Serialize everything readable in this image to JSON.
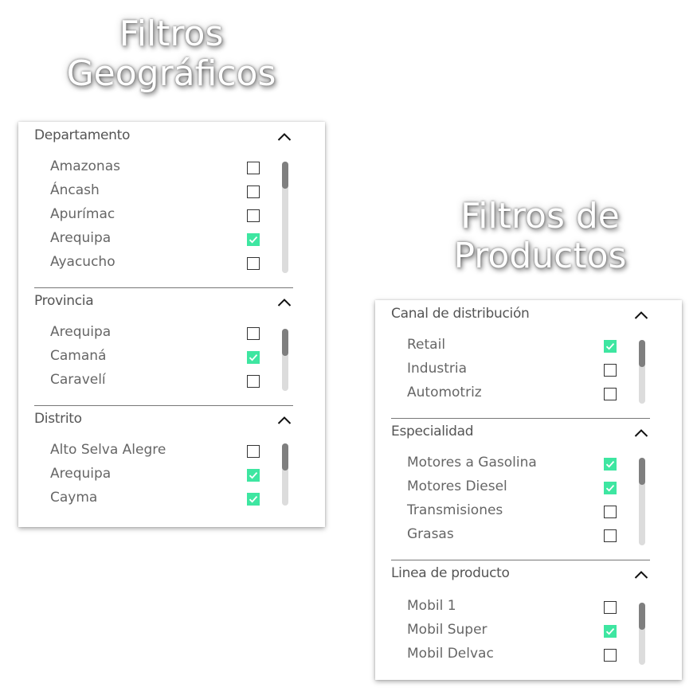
{
  "geo": {
    "title_line1": "Filtros",
    "title_line2": "Geográficos",
    "sections": [
      {
        "header": "Departamento",
        "items": [
          {
            "label": "Amazonas",
            "checked": false
          },
          {
            "label": "Áncash",
            "checked": false
          },
          {
            "label": "Apurímac",
            "checked": false
          },
          {
            "label": "Arequipa",
            "checked": true
          },
          {
            "label": "Ayacucho",
            "checked": false
          }
        ]
      },
      {
        "header": "Provincia",
        "items": [
          {
            "label": "Arequipa",
            "checked": false
          },
          {
            "label": "Camaná",
            "checked": true
          },
          {
            "label": "Caravelí",
            "checked": false
          }
        ]
      },
      {
        "header": "Distrito",
        "items": [
          {
            "label": "Alto Selva Alegre",
            "checked": false
          },
          {
            "label": "Arequipa",
            "checked": true
          },
          {
            "label": "Cayma",
            "checked": true
          }
        ]
      }
    ]
  },
  "prod": {
    "title_line1": "Filtros de",
    "title_line2": "Productos",
    "sections": [
      {
        "header": "Canal de distribución",
        "items": [
          {
            "label": "Retail",
            "checked": true
          },
          {
            "label": "Industria",
            "checked": false
          },
          {
            "label": "Automotriz",
            "checked": false
          }
        ]
      },
      {
        "header": "Especialidad",
        "items": [
          {
            "label": "Motores a Gasolina",
            "checked": true
          },
          {
            "label": "Motores Diesel",
            "checked": true
          },
          {
            "label": "Transmisiones",
            "checked": false
          },
          {
            "label": "Grasas",
            "checked": false
          }
        ]
      },
      {
        "header": "Linea de producto",
        "items": [
          {
            "label": "Mobil 1",
            "checked": false
          },
          {
            "label": "Mobil Super",
            "checked": true
          },
          {
            "label": "Mobil Delvac",
            "checked": false
          }
        ]
      }
    ]
  },
  "colors": {
    "checked": "#3ee6a1",
    "header_text": "#555555",
    "item_text": "#666666"
  },
  "icons": {
    "collapse": "chevron-up-icon",
    "check": "checkmark-icon"
  }
}
